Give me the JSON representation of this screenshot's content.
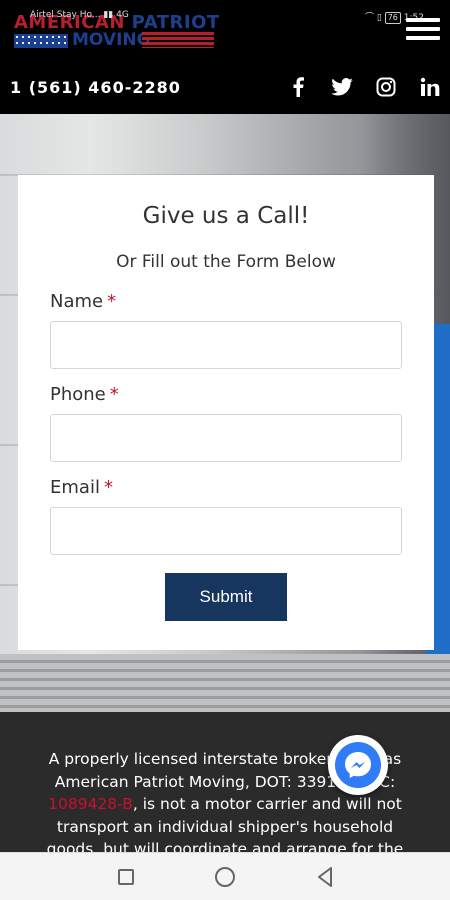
{
  "status_bar": {
    "carrier": "Airtel Stay Ho...",
    "network": "4G",
    "battery": "76",
    "time": "1:52"
  },
  "header": {
    "logo_line1_red": "AMERICAN ",
    "logo_line1_blue": "PATRIOT",
    "logo_line2": "MOVING",
    "menu_icon": "hamburger-menu-icon"
  },
  "topbar": {
    "phone": "1 (561) 460-2280",
    "social": [
      {
        "name": "facebook-icon",
        "glyph": "f"
      },
      {
        "name": "twitter-icon",
        "glyph": "t"
      },
      {
        "name": "instagram-icon",
        "glyph": "ig"
      },
      {
        "name": "linkedin-icon",
        "glyph": "in"
      }
    ]
  },
  "form": {
    "title": "Give us a Call!",
    "subtitle": "Or Fill out the Form Below",
    "fields": [
      {
        "label": "Name",
        "required_mark": "*",
        "value": ""
      },
      {
        "label": "Phone",
        "required_mark": "*",
        "value": ""
      },
      {
        "label": "Email",
        "required_mark": "*",
        "value": ""
      }
    ],
    "submit_label": "Submit"
  },
  "footer": {
    "line1": "A properly licensed interstate broker, such as",
    "line2": "American Patriot Moving, DOT: 3391",
    "line2_tail": "MC:",
    "mc_number": "1089428-B",
    "line3_rest": ", is not a motor carrier and will not",
    "line4": "transport an individual shipper's household",
    "line5": "goods, but will coordinate and arrange for the"
  },
  "colors": {
    "accent_red": "#c8102e",
    "button_navy": "#16355f",
    "brand_blue": "#1c3f8f",
    "footer_bg": "#2b2b2b",
    "messenger_blue": "#2f7cf6"
  }
}
